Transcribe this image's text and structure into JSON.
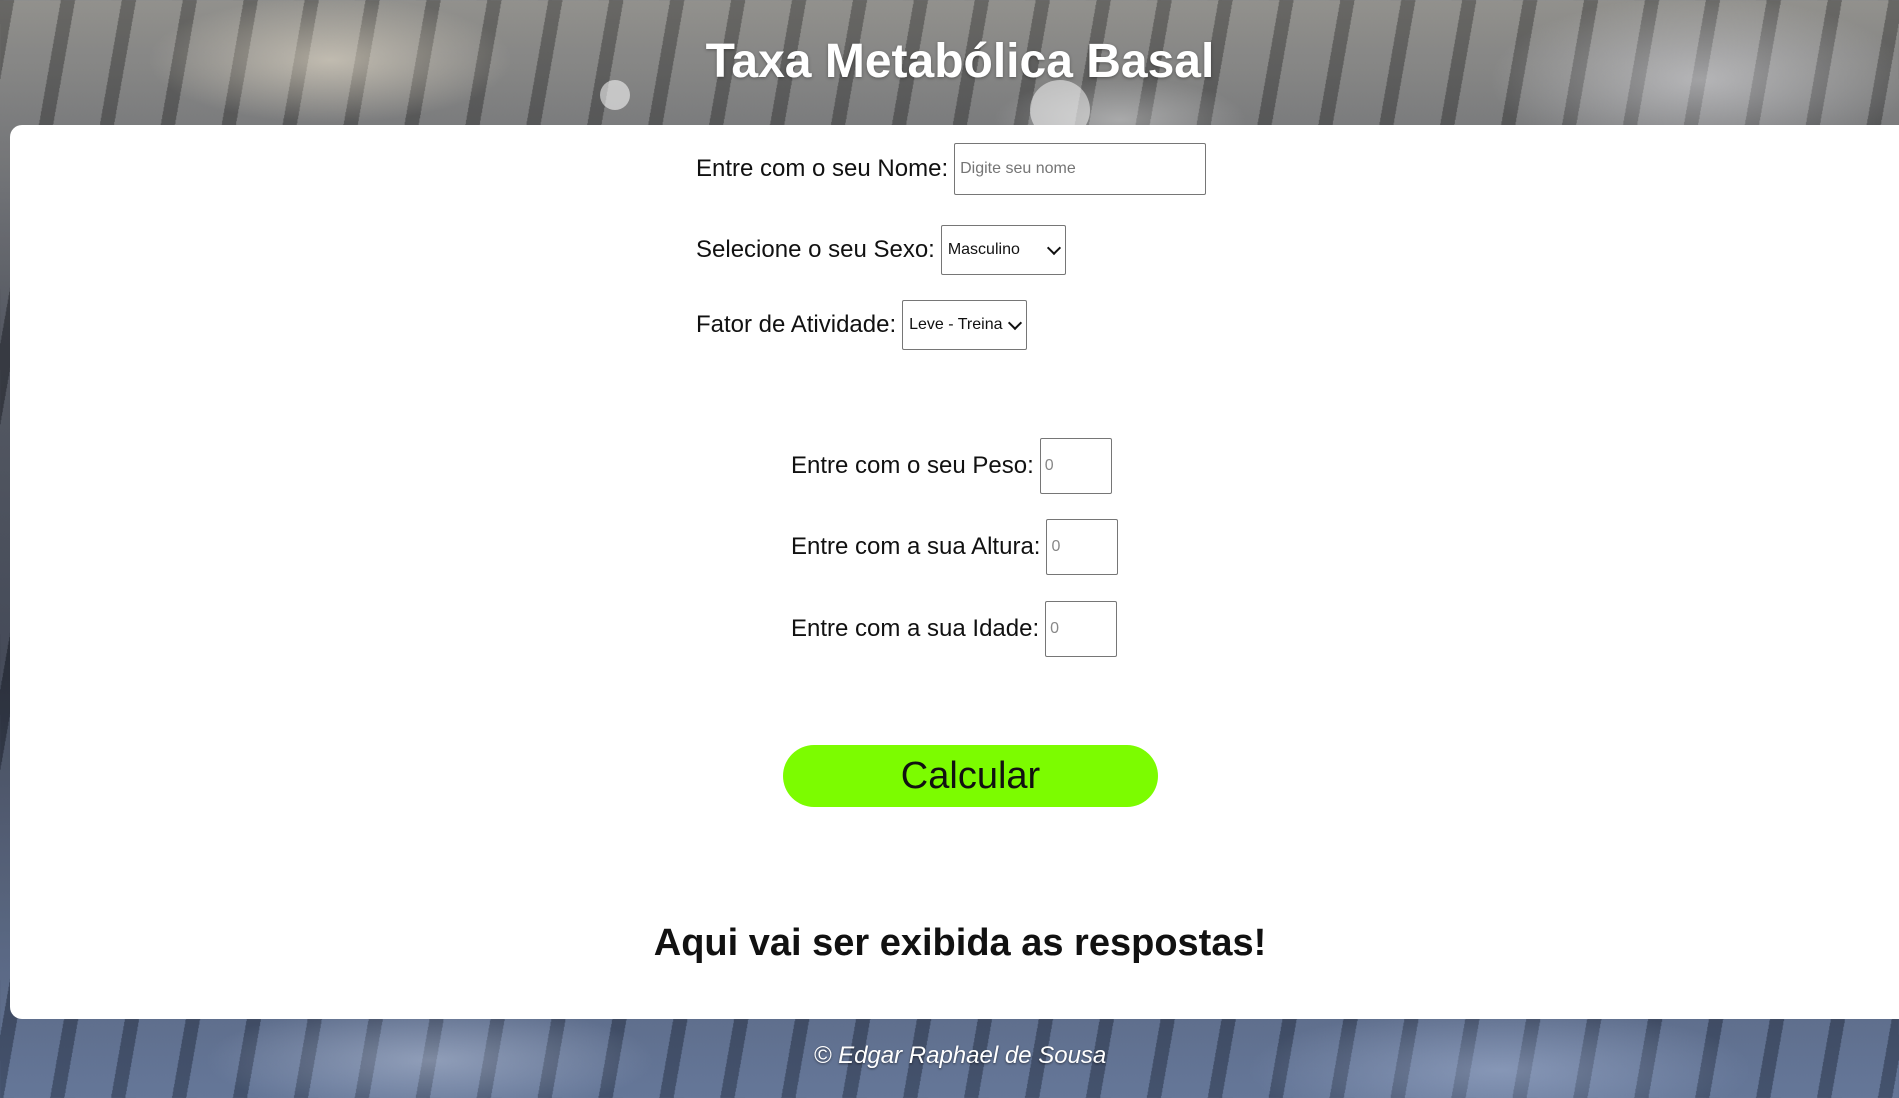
{
  "header": {
    "title": "Taxa Metabólica Basal"
  },
  "form": {
    "name": {
      "label": "Entre com o seu Nome:",
      "placeholder": "Digite seu nome"
    },
    "sex": {
      "label": "Selecione o seu Sexo:",
      "selected": "Masculino"
    },
    "activity": {
      "label": "Fator de Atividade:",
      "selected": "Leve - Treina"
    },
    "weight": {
      "label": "Entre com o seu Peso:",
      "placeholder": "0"
    },
    "height": {
      "label": "Entre com a sua Altura:",
      "placeholder": "0"
    },
    "age": {
      "label": "Entre com a sua Idade:",
      "placeholder": "0"
    },
    "submit_label": "Calcular"
  },
  "result": {
    "text": "Aqui vai ser exibida as respostas!"
  },
  "footer": {
    "text": "© Edgar Raphael de Sousa"
  },
  "colors": {
    "button": "#7cfc00",
    "panel": "#ffffff",
    "title_text": "#ffffff"
  }
}
